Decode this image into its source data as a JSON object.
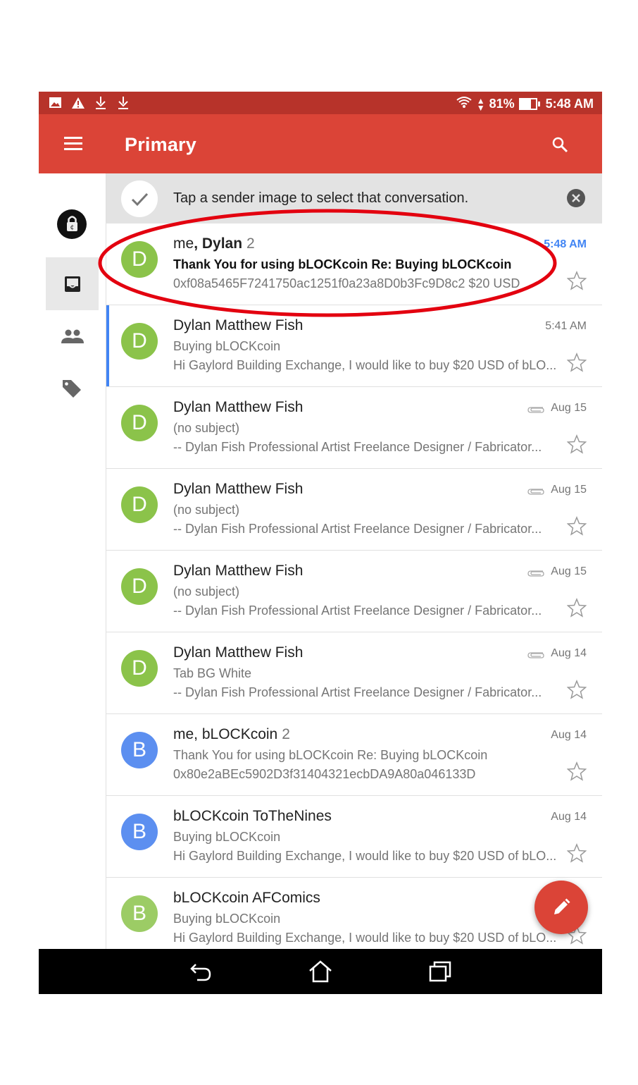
{
  "status_bar": {
    "battery": "81%",
    "time": "5:48 AM",
    "left_icons": [
      "image-icon",
      "warning-icon",
      "download-icon",
      "download-icon"
    ]
  },
  "app_bar": {
    "title": "Primary"
  },
  "tip_banner": {
    "text": "Tap a sender image to select that conversation."
  },
  "emails": [
    {
      "avatar_letter": "D",
      "avatar_color": "#8bc34a",
      "sender_plain": "me",
      "sender_bold": ", Dylan",
      "count": "2",
      "subject": "Thank You for using bLOCKcoin Re: Buying bLOCKcoin",
      "snippet": "0xf08a5465F7241750ac1251f0a23a8D0b3Fc9D8c2 $20 USD",
      "date": "5:48 AM",
      "unread": true
    },
    {
      "avatar_letter": "D",
      "avatar_color": "#8bc34a",
      "sender_plain": "Dylan Matthew Fish",
      "sender_bold": "",
      "count": "",
      "subject": "Buying bLOCKcoin",
      "snippet": "Hi Gaylord Building Exchange, I would like to buy $20 USD of bLO...",
      "date": "5:41 AM"
    },
    {
      "avatar_letter": "D",
      "avatar_color": "#8bc34a",
      "sender_plain": "Dylan Matthew Fish",
      "sender_bold": "",
      "count": "",
      "subject": "(no subject)",
      "snippet": "-- Dylan Fish Professional Artist Freelance Designer / Fabricator...",
      "date": "Aug 15",
      "attachment": true
    },
    {
      "avatar_letter": "D",
      "avatar_color": "#8bc34a",
      "sender_plain": "Dylan Matthew Fish",
      "sender_bold": "",
      "count": "",
      "subject": "(no subject)",
      "snippet": "-- Dylan Fish Professional Artist Freelance Designer / Fabricator...",
      "date": "Aug 15",
      "attachment": true
    },
    {
      "avatar_letter": "D",
      "avatar_color": "#8bc34a",
      "sender_plain": "Dylan Matthew Fish",
      "sender_bold": "",
      "count": "",
      "subject": "(no subject)",
      "snippet": "-- Dylan Fish Professional Artist Freelance Designer / Fabricator...",
      "date": "Aug 15",
      "attachment": true
    },
    {
      "avatar_letter": "D",
      "avatar_color": "#8bc34a",
      "sender_plain": "Dylan Matthew Fish",
      "sender_bold": "",
      "count": "",
      "subject": "Tab BG White",
      "snippet": "-- Dylan Fish Professional Artist Freelance Designer / Fabricator...",
      "date": "Aug 14",
      "attachment": true
    },
    {
      "avatar_letter": "B",
      "avatar_color": "#5c8ff0",
      "sender_plain": "me, bLOCKcoin",
      "sender_bold": "",
      "count": "2",
      "subject": "Thank You for using bLOCKcoin Re: Buying bLOCKcoin",
      "snippet": "0x80e2aBEc5902D3f31404321ecbDA9A80a046133D",
      "date": "Aug 14"
    },
    {
      "avatar_letter": "B",
      "avatar_color": "#5c8ff0",
      "sender_plain": "bLOCKcoin ToTheNines",
      "sender_bold": "",
      "count": "",
      "subject": "Buying bLOCKcoin",
      "snippet": "Hi Gaylord Building Exchange, I would like to buy $20 USD of bLO...",
      "date": "Aug 14"
    },
    {
      "avatar_letter": "B",
      "avatar_color": "#9ccc65",
      "sender_plain": "bLOCKcoin AFComics",
      "sender_bold": "",
      "count": "",
      "subject": "Buying bLOCKcoin",
      "snippet": "Hi Gaylord Building Exchange, I would like to buy $20 USD of bLO...",
      "date": ""
    }
  ],
  "colors": {
    "status_bar": "#b7332a",
    "app_bar": "#db4437",
    "accent_blue": "#4285f4",
    "annotation": "#e3000f"
  }
}
